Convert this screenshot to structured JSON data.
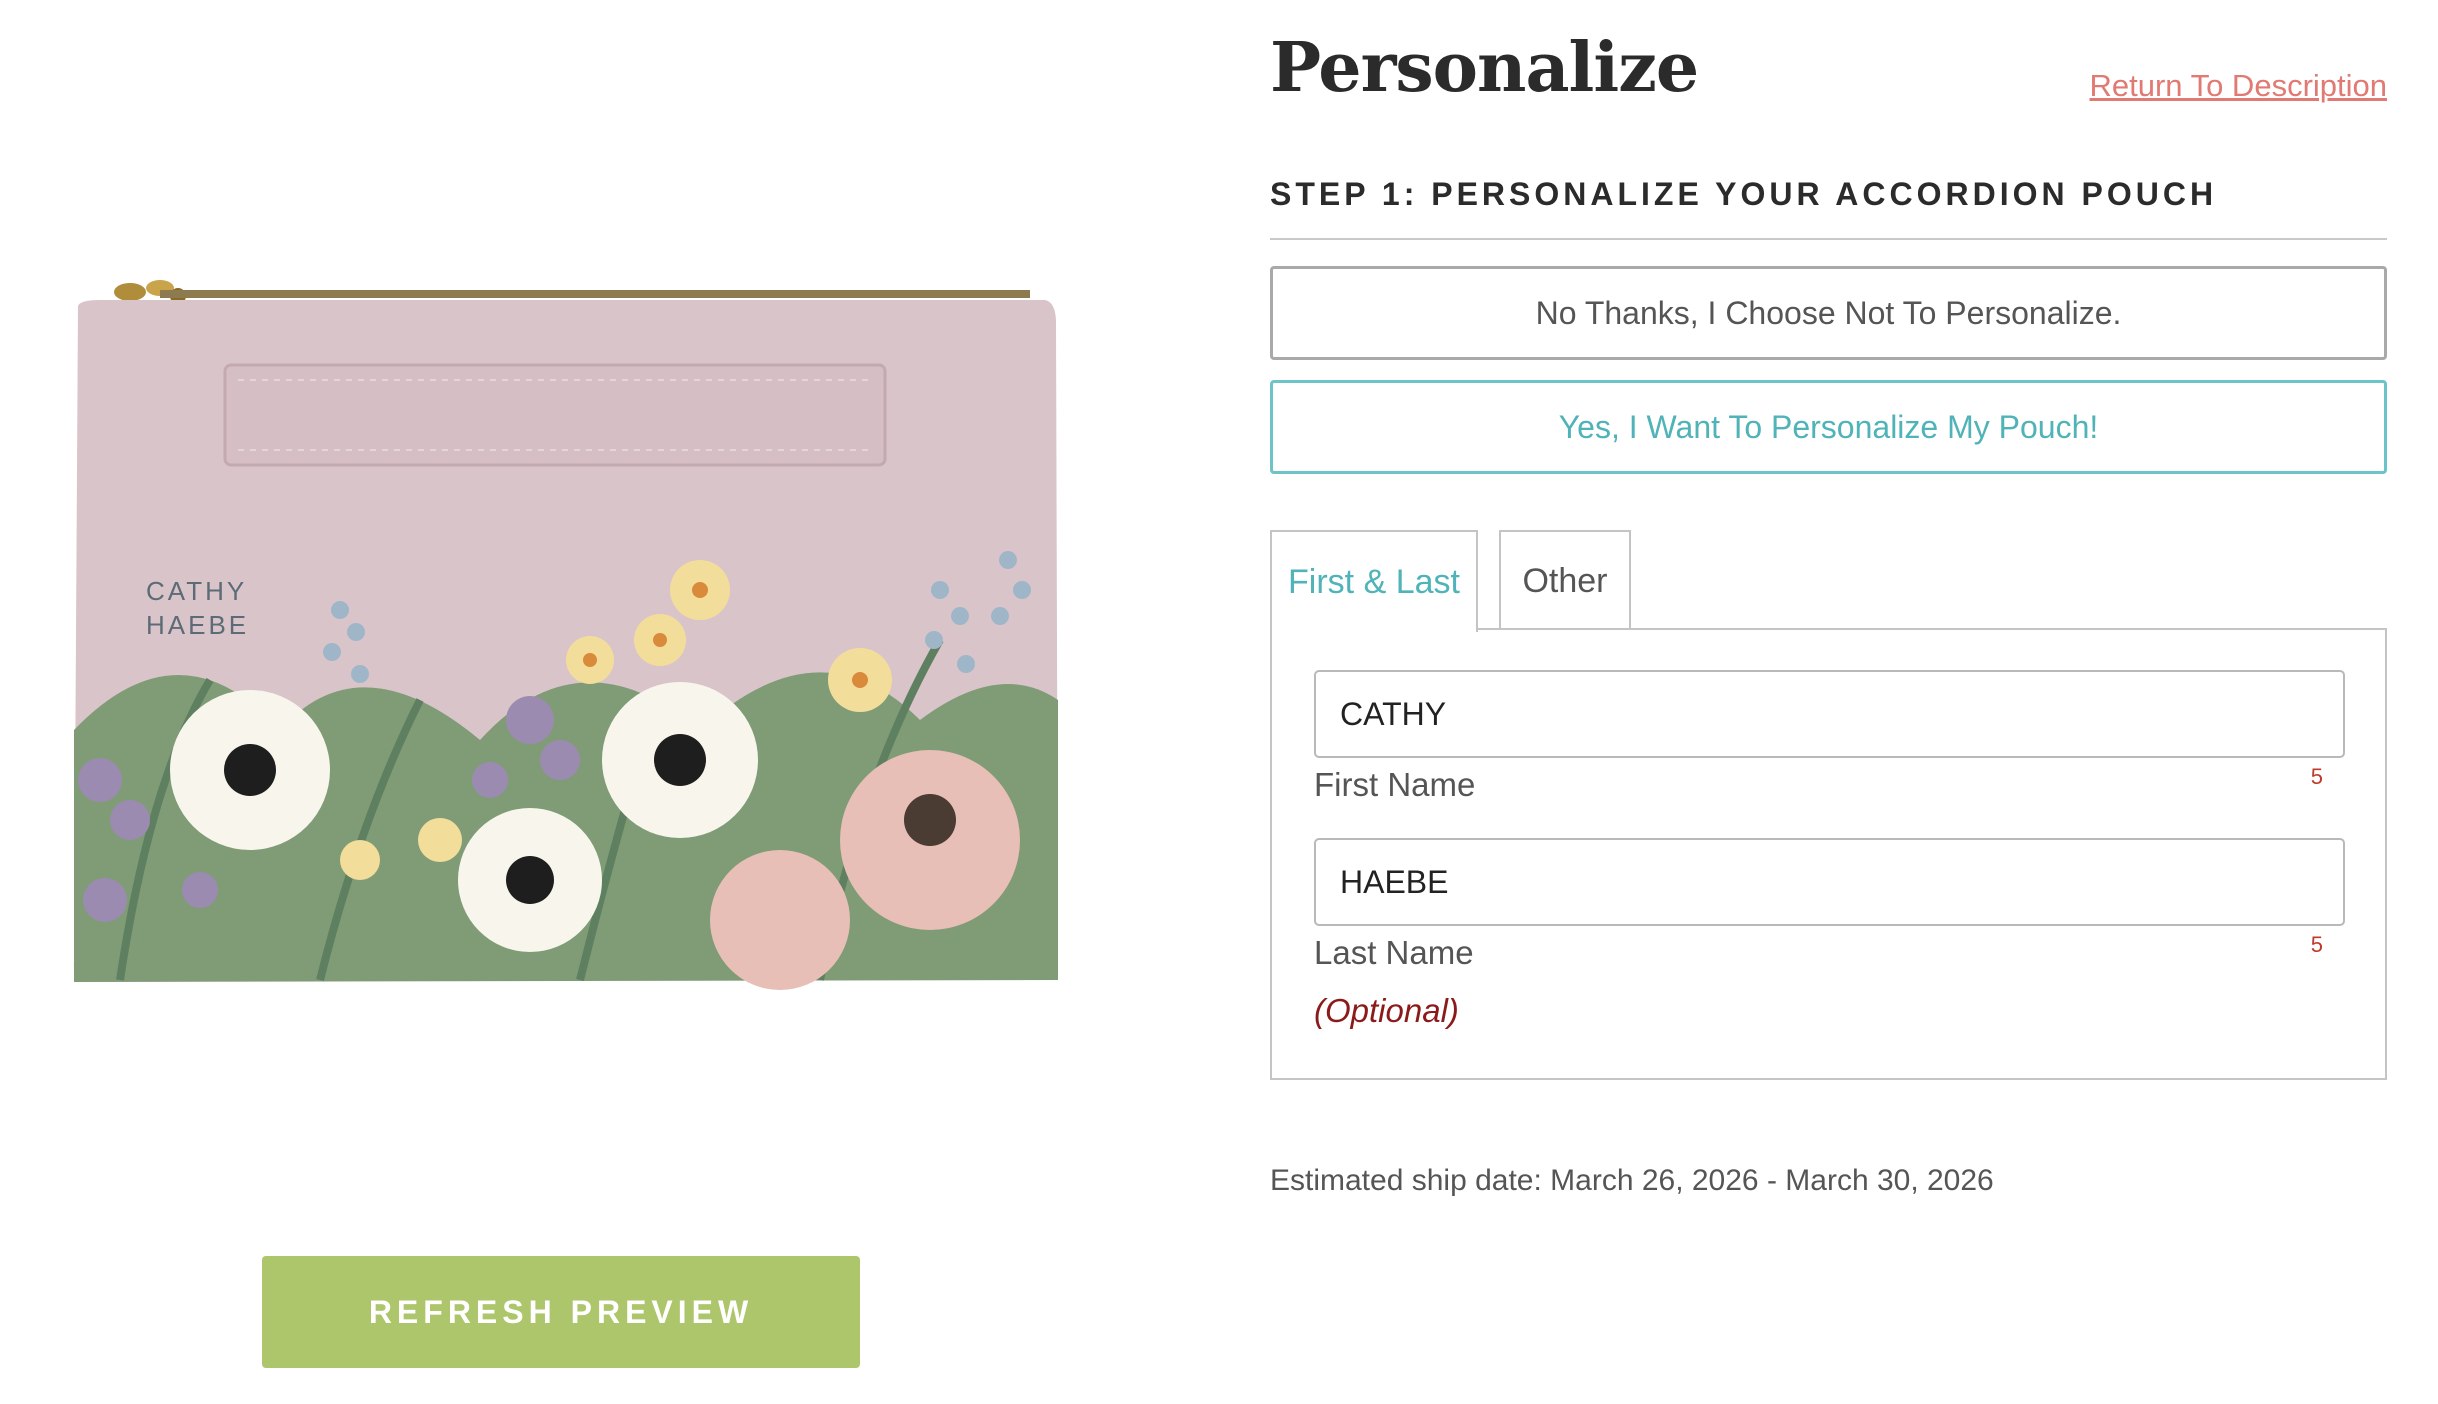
{
  "preview": {
    "pouch_first_name": "CATHY",
    "pouch_last_name": "HAEBE",
    "refresh_label": "REFRESH PREVIEW",
    "pouch_color": "#d9c4c9",
    "button_color": "#adc56b"
  },
  "personalize": {
    "title": "Personalize",
    "return_link": "Return To Description",
    "step_heading": "STEP 1: PERSONALIZE YOUR ACCORDION POUCH",
    "option_no": "No Thanks, I Choose Not To Personalize.",
    "option_yes": "Yes, I Want To Personalize My Pouch!",
    "selected_option": "yes",
    "accent_color": "#4fb3b8",
    "tabs": [
      {
        "label": "First & Last",
        "active": true
      },
      {
        "label": "Other",
        "active": false
      }
    ],
    "fields": {
      "first_name": {
        "value": "CATHY",
        "label": "First Name",
        "remaining": "5"
      },
      "last_name": {
        "value": "HAEBE",
        "label": "Last Name",
        "remaining": "5",
        "note": "(Optional)"
      }
    },
    "ship_date": "Estimated ship date: March 26, 2026 - March 30, 2026"
  }
}
